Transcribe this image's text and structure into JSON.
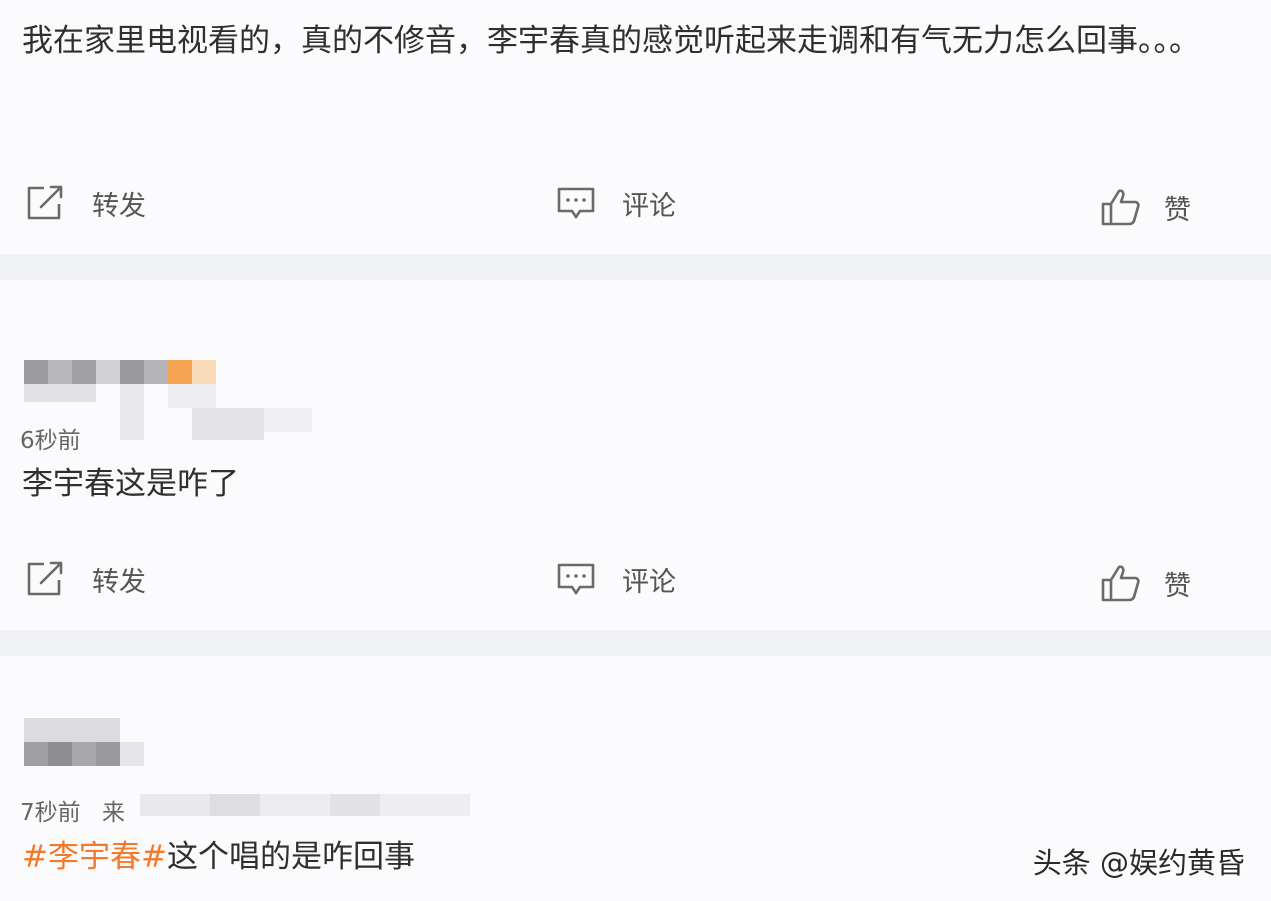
{
  "post1": {
    "text": "我在家里电视看的，真的不修音，李宇春真的感觉听起来走调和有气无力怎么回事。。。"
  },
  "actions": {
    "repost_label": "转发",
    "comment_label": "评论",
    "like_label": "赞"
  },
  "post2": {
    "time": "6秒前",
    "text": "李宇春这是咋了"
  },
  "post3": {
    "time": "7秒前",
    "source_prefix": "来",
    "hashtag": "#李宇春#",
    "text": "这个唱的是咋回事"
  },
  "watermark": "头条 @娱约黄昏",
  "colors": {
    "background": "#fbfbfd",
    "separator": "#f0f1f4",
    "hashtag": "#f37a2b",
    "icon": "#6a6a6a"
  },
  "icons": [
    "repost-icon",
    "comment-icon",
    "like-icon"
  ]
}
